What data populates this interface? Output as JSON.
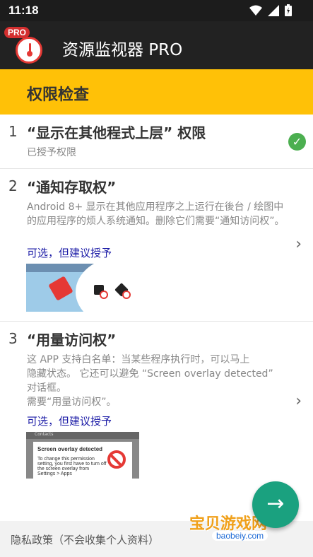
{
  "status_bar": {
    "time": "11:18"
  },
  "app_bar": {
    "title": "资源监视器 PRO",
    "pro_badge": "PRO"
  },
  "section": {
    "title": "权限检查"
  },
  "permissions": [
    {
      "number": "1",
      "title": "“显示在其他程式上层” 权限",
      "status": "已授予权限",
      "granted": true
    },
    {
      "number": "2",
      "title": "“通知存取权”",
      "description": "Android 8+ 显示在其他应用程序之上运行在後台 / 绘图中的应用程序的烦人系统通知。删除它们需要“通知访问权”。",
      "link": "可选，但建议授予"
    },
    {
      "number": "3",
      "title": "“用量访问权”",
      "description_lines": [
        "这 APP 支持白名单：当某些程序执行时，可以马上",
        "隐藏状态。 它还可以避免 “Screen overlay detected”",
        "对话框。",
        "需要“用量访问权”。"
      ],
      "link": "可选，但建议授予"
    }
  ],
  "thumb2": {
    "bar": "Contacts",
    "dialog_title": "Screen overlay detected",
    "dialog_text": "To change this permission setting, you first have to turn off the screen overlay from Settings > Apps"
  },
  "footer": {
    "privacy": "隐私政策（不会收集个人资料）"
  },
  "watermark": {
    "brand": "宝贝游戏网",
    "url": "baobeiy.com"
  },
  "colors": {
    "accent": "#ffc107",
    "fab": "#1aa17f",
    "link": "#1a1aa6",
    "check": "#4caf50"
  }
}
